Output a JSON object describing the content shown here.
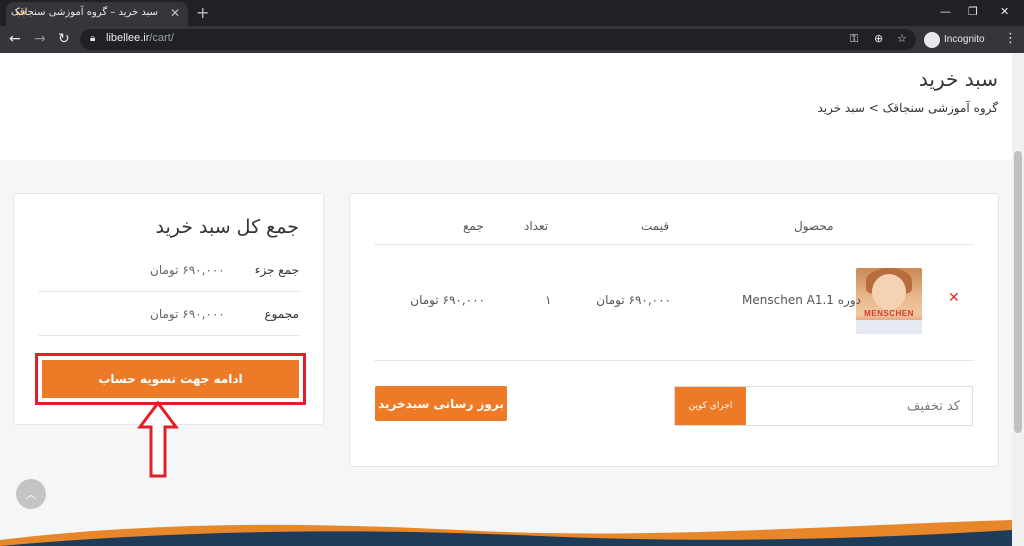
{
  "browser": {
    "tab_title": "سبد خرید – گروه آموزشی سنجاقک",
    "url_host": "libellee.ir",
    "url_path": "/cart/",
    "incognito_label": "Incognito",
    "icons": [
      "butterfly-favicon",
      "close-icon",
      "plus-icon",
      "back-icon",
      "forward-icon",
      "reload-icon",
      "lock-icon",
      "key-icon",
      "zoom-icon",
      "star-icon",
      "incognito-icon",
      "more-icon",
      "minimize-icon",
      "restore-icon",
      "window-close-icon"
    ]
  },
  "header": {
    "title": "سبد خرید",
    "breadcrumb": "گروه آموزشی سنجاقک > سبد خرید"
  },
  "cart": {
    "columns": {
      "product": "محصول",
      "price": "قیمت",
      "quantity": "تعداد",
      "subtotal": "جمع"
    },
    "items": [
      {
        "image_brand": "MENSCHEN",
        "name": "دوره Menschen A1.1",
        "price": "۶۹۰,۰۰۰ تومان",
        "quantity": "۱",
        "subtotal": "۶۹۰,۰۰۰ تومان"
      }
    ],
    "coupon_placeholder": "کد تخفیف",
    "apply_coupon_label": "اجرای کوپن",
    "update_cart_label": "بروز رسانی سبدخرید"
  },
  "totals": {
    "title": "جمع کل سبد خرید",
    "subtotal_label": "جمع جزء",
    "subtotal_value": "۶۹۰,۰۰۰ تومان",
    "total_label": "مجموع",
    "total_value": "۶۹۰,۰۰۰ تومان",
    "checkout_label": "ادامه جهت تسویه حساب"
  },
  "colors": {
    "accent": "#ec7a27",
    "highlight": "#e11f26",
    "wave_orange": "#e8862a",
    "wave_navy": "#1f3b5a"
  }
}
